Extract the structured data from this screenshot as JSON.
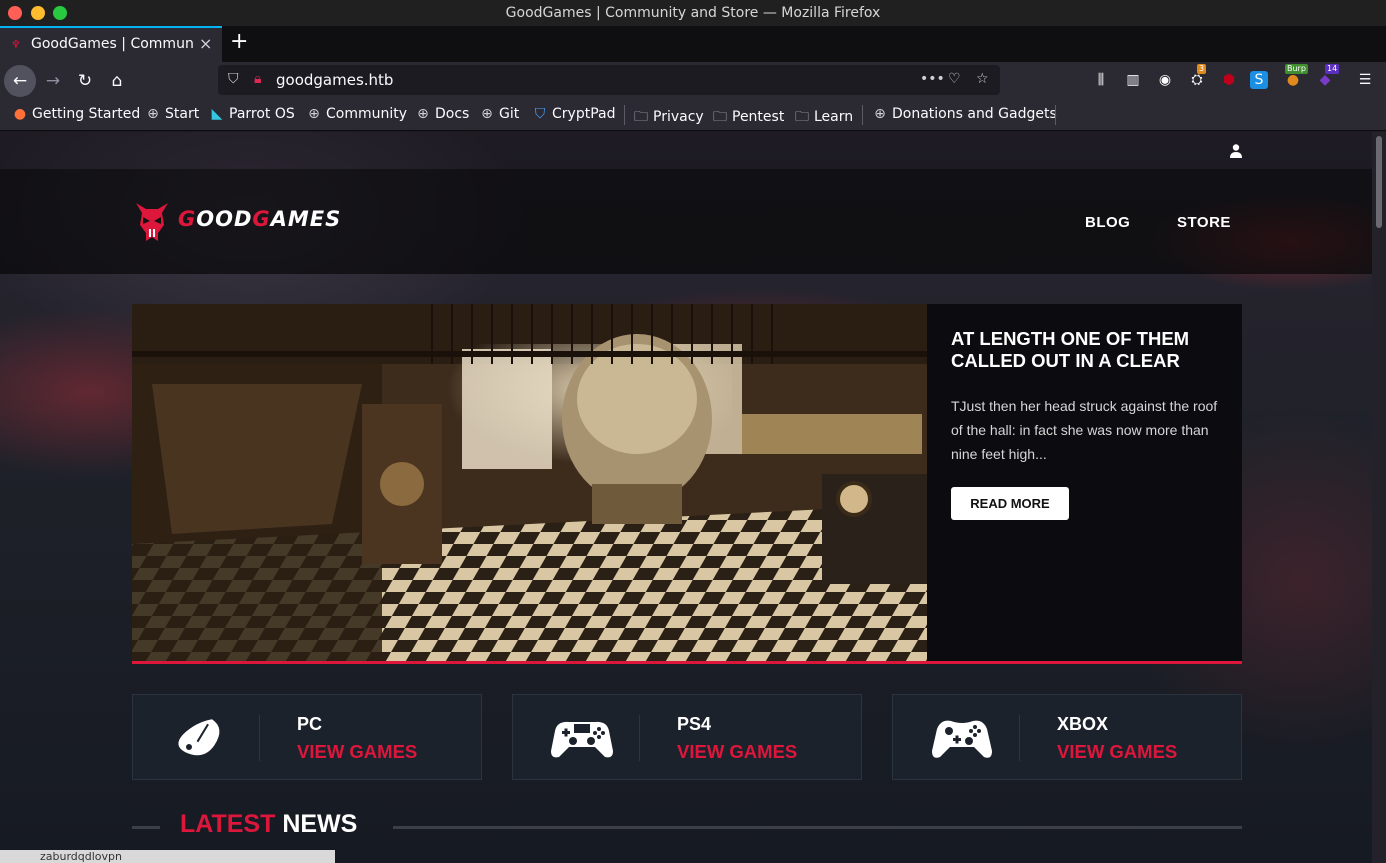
{
  "window": {
    "title": "GoodGames | Community and Store — Mozilla Firefox"
  },
  "tab": {
    "title": "GoodGames | Community and Store",
    "close": "×",
    "new": "+"
  },
  "nav": {
    "url": "goodgames.htb"
  },
  "toolbar_badges": {
    "badge1": "3",
    "burp": "Burp",
    "badge14": "14"
  },
  "bookmarks": [
    {
      "label": "Getting Started",
      "icon": "firefox-icon"
    },
    {
      "label": "Start",
      "icon": "globe-icon"
    },
    {
      "label": "Parrot OS",
      "icon": "parrot-icon"
    },
    {
      "label": "Community",
      "icon": "globe-icon"
    },
    {
      "label": "Docs",
      "icon": "globe-icon"
    },
    {
      "label": "Git",
      "icon": "globe-icon"
    },
    {
      "label": "CryptPad",
      "icon": "cryptpad-icon"
    },
    {
      "label": "Privacy",
      "icon": "folder-icon"
    },
    {
      "label": "Pentest",
      "icon": "folder-icon"
    },
    {
      "label": "Learn",
      "icon": "folder-icon"
    },
    {
      "label": "Donations and Gadgets",
      "icon": "globe-icon"
    }
  ],
  "site": {
    "logo_part1": "G",
    "logo_part2": "OOD",
    "logo_part3": "G",
    "logo_part4": "AMES",
    "menu": {
      "blog": "BLOG",
      "store": "STORE"
    },
    "hero": {
      "title": "AT LENGTH ONE OF THEM CALLED OUT IN A CLEAR",
      "text": "TJust then her head struck against the roof of the hall: in fact she was now more than nine feet high...",
      "button": "READ MORE"
    },
    "categories": [
      {
        "name": "PC",
        "link": "VIEW GAMES",
        "icon": "mouse-icon"
      },
      {
        "name": "PS4",
        "link": "VIEW GAMES",
        "icon": "ps4-controller-icon"
      },
      {
        "name": "XBOX",
        "link": "VIEW GAMES",
        "icon": "xbox-controller-icon"
      }
    ],
    "news": {
      "title_red": "LATEST",
      "title_white": "NEWS"
    }
  },
  "bottom_peek": "zaburdqdlovpn"
}
